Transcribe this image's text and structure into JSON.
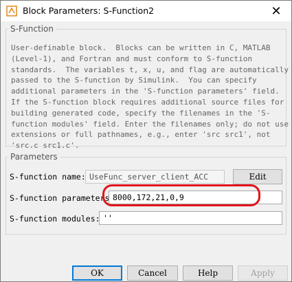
{
  "window": {
    "title": "Block Parameters: S-Function2",
    "close_glyph": "✕"
  },
  "description": {
    "legend": "S-Function",
    "text": "User-definable block.  Blocks can be written in C, MATLAB\n(Level-1), and Fortran and must conform to S-function\nstandards.  The variables t, x, u, and flag are automatically\npassed to the S-function by Simulink.  You can specify\nadditional parameters in the 'S-function parameters' field.\nIf the S-function block requires additional source files for\nbuilding generated code, specify the filenames in the 'S-\nfunction modules' field. Enter the filenames only; do not use\nextensions or full pathnames, e.g., enter 'src src1', not\n'src.c src1.c'."
  },
  "parameters": {
    "legend": "Parameters",
    "name_label": "S-function name:",
    "name_value": "UseFunc_server_client_ACC",
    "edit_button": "Edit",
    "params_label": "S-function parameters",
    "params_value": "8000,172,21,0,9",
    "modules_label": "S-function modules:",
    "modules_value": "''"
  },
  "buttons": {
    "ok": "OK",
    "cancel": "Cancel",
    "help": "Help",
    "apply": "Apply"
  },
  "colors": {
    "annotation_ring": "#e2121c",
    "default_button_border": "#0078d7"
  }
}
